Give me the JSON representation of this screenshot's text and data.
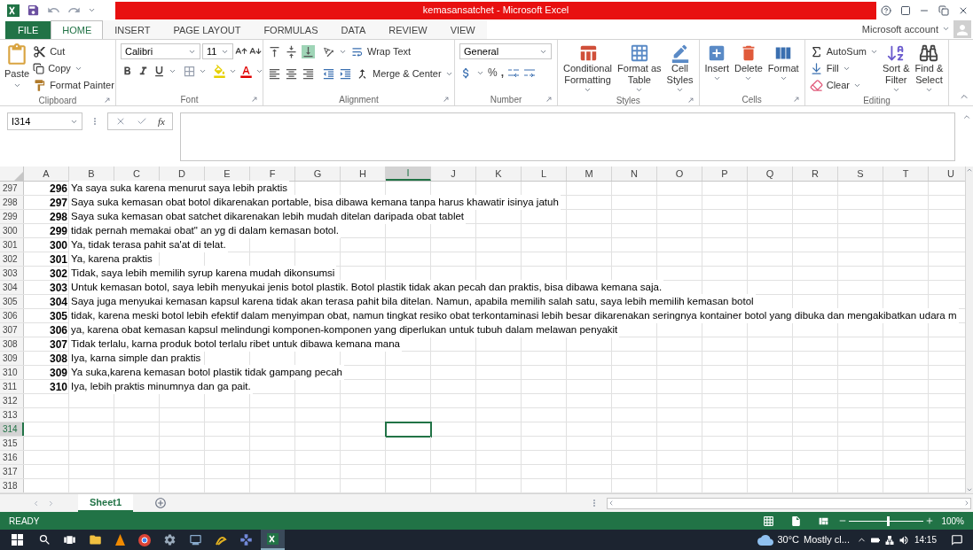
{
  "window": {
    "title": "kemasansatchet - Microsoft Excel"
  },
  "ribbon_tabs": [
    {
      "label": "FILE",
      "kind": "file",
      "selected": false
    },
    {
      "label": "HOME",
      "kind": "tab",
      "selected": true
    },
    {
      "label": "INSERT",
      "kind": "tab",
      "selected": false
    },
    {
      "label": "PAGE LAYOUT",
      "kind": "tab",
      "selected": false
    },
    {
      "label": "FORMULAS",
      "kind": "tab",
      "selected": false
    },
    {
      "label": "DATA",
      "kind": "tab",
      "selected": false
    },
    {
      "label": "REVIEW",
      "kind": "tab",
      "selected": false
    },
    {
      "label": "VIEW",
      "kind": "tab",
      "selected": false
    }
  ],
  "account": "Microsoft account",
  "clipboard": {
    "title": "Clipboard",
    "paste": "Paste",
    "cut": "Cut",
    "copy": "Copy",
    "format_painter": "Format Painter"
  },
  "font": {
    "title": "Font",
    "font_name": "Calibri",
    "font_size": "11"
  },
  "alignment": {
    "title": "Alignment",
    "wrap_text": "Wrap Text",
    "merge_center": "Merge & Center"
  },
  "number": {
    "title": "Number",
    "format": "General",
    "percent": "%",
    "comma": ","
  },
  "styles": {
    "title": "Styles",
    "buttons": [
      {
        "lines": [
          "Conditional",
          "Formatting"
        ]
      },
      {
        "lines": [
          "Format as",
          "Table"
        ]
      },
      {
        "lines": [
          "Cell",
          "Styles"
        ]
      }
    ]
  },
  "cells": {
    "title": "Cells",
    "buttons": [
      "Insert",
      "Delete",
      "Format"
    ]
  },
  "editing": {
    "title": "Editing",
    "autosum": "AutoSum",
    "fill": "Fill",
    "clear": "Clear",
    "sort": [
      "Sort &",
      "Filter"
    ],
    "find": [
      "Find &",
      "Select"
    ]
  },
  "formula_bar": {
    "name_box": "I314",
    "function_label": "fx"
  },
  "columns": [
    {
      "label": "A",
      "selected": false
    },
    {
      "label": "B",
      "selected": false
    },
    {
      "label": "C",
      "selected": false
    },
    {
      "label": "D",
      "selected": false
    },
    {
      "label": "E",
      "selected": false
    },
    {
      "label": "F",
      "selected": false
    },
    {
      "label": "G",
      "selected": false
    },
    {
      "label": "H",
      "selected": false
    },
    {
      "label": "I",
      "selected": true
    },
    {
      "label": "J",
      "selected": false
    },
    {
      "label": "K",
      "selected": false
    },
    {
      "label": "L",
      "selected": false
    },
    {
      "label": "M",
      "selected": false
    },
    {
      "label": "N",
      "selected": false
    },
    {
      "label": "O",
      "selected": false
    },
    {
      "label": "P",
      "selected": false
    },
    {
      "label": "Q",
      "selected": false
    },
    {
      "label": "R",
      "selected": false
    },
    {
      "label": "S",
      "selected": false
    },
    {
      "label": "T",
      "selected": false
    },
    {
      "label": "U",
      "selected": false
    }
  ],
  "rows": [
    {
      "header": "297",
      "a": "296",
      "b": "Ya saya suka karena menurut saya lebih praktis",
      "selected": false
    },
    {
      "header": "298",
      "a": "297",
      "b": "Saya suka kemasan obat botol dikarenakan portable, bisa dibawa kemana tanpa harus khawatir isinya jatuh",
      "selected": false
    },
    {
      "header": "299",
      "a": "298",
      "b": "Saya suka kemasan obat satchet dikarenakan lebih mudah ditelan daripada obat tablet",
      "selected": false
    },
    {
      "header": "300",
      "a": "299",
      "b": "tidak pernah memakai obat\" an yg di dalam kemasan botol.",
      "selected": false
    },
    {
      "header": "301",
      "a": "300",
      "b": "Ya, tidak terasa pahit sa'at di telat.",
      "selected": false
    },
    {
      "header": "302",
      "a": "301",
      "b": "Ya, karena praktis",
      "selected": false
    },
    {
      "header": "303",
      "a": "302",
      "b": "Tidak, saya lebih memilih syrup karena mudah dikonsumsi",
      "selected": false
    },
    {
      "header": "304",
      "a": "303",
      "b": "Untuk kemasan botol, saya lebih menyukai jenis botol plastik. Botol plastik tidak akan pecah dan praktis, bisa dibawa kemana saja.",
      "selected": false
    },
    {
      "header": "305",
      "a": "304",
      "b": "Saya juga menyukai kemasan kapsul karena tidak akan terasa pahit bila ditelan. Namun, apabila memilih salah satu, saya lebih memilih kemasan botol",
      "selected": false
    },
    {
      "header": "306",
      "a": "305",
      "b": "tidak, karena meski botol lebih efektif dalam menyimpan obat, namun tingkat resiko obat terkontaminasi lebih besar dikarenakan seringnya kontainer botol yang dibuka dan mengakibatkan udara m",
      "selected": false
    },
    {
      "header": "307",
      "a": "306",
      "b": "ya, karena obat kemasan kapsul melindungi komponen-komponen yang diperlukan untuk tubuh dalam melawan penyakit",
      "selected": false
    },
    {
      "header": "308",
      "a": "307",
      "b": "Tidak terlalu, karna produk botol terlalu ribet untuk dibawa kemana mana",
      "selected": false
    },
    {
      "header": "309",
      "a": "308",
      "b": "Iya, karna simple dan praktis",
      "selected": false
    },
    {
      "header": "310",
      "a": "309",
      "b": "Ya suka,karena kemasan botol plastik tidak gampang pecah",
      "selected": false
    },
    {
      "header": "311",
      "a": "310",
      "b": "Iya, lebih praktis minumnya dan ga pait.",
      "selected": false
    },
    {
      "header": "312",
      "selected": false
    },
    {
      "header": "313",
      "selected": false
    },
    {
      "header": "314",
      "selected": true
    },
    {
      "header": "315",
      "selected": false
    },
    {
      "header": "316",
      "selected": false
    },
    {
      "header": "317",
      "selected": false
    },
    {
      "header": "318",
      "selected": false
    }
  ],
  "sheet_tabs": [
    {
      "label": "Sheet1",
      "selected": true
    }
  ],
  "status_bar": {
    "status": "READY",
    "zoom": "100%",
    "zoom_slider": {
      "level": 0.52
    }
  },
  "taskbar": {
    "temperature": "30°C",
    "weather": "Mostly cl...",
    "time": "14:15"
  }
}
